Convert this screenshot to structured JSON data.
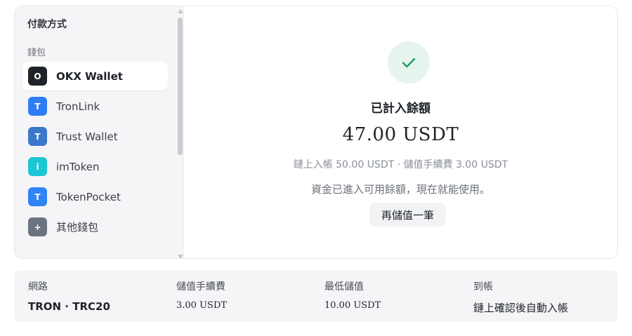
{
  "sidebar": {
    "title": "付款方式",
    "section": "錢包",
    "wallets": [
      {
        "label": "OKX Wallet",
        "icon_text": "O",
        "icon_color": "#1f2329",
        "active": true
      },
      {
        "label": "TronLink",
        "icon_text": "T",
        "icon_color": "#2f7cf6",
        "active": false
      },
      {
        "label": "Trust Wallet",
        "icon_text": "T",
        "icon_color": "#3b78c9",
        "active": false
      },
      {
        "label": "imToken",
        "icon_text": "i",
        "icon_color": "#1cc6d4",
        "active": false
      },
      {
        "label": "TokenPocket",
        "icon_text": "T",
        "icon_color": "#2f84f6",
        "active": false
      },
      {
        "label": "其他錢包",
        "icon_text": "+",
        "icon_color": "#6b7280",
        "active": false
      }
    ]
  },
  "main": {
    "status_title": "已計入餘額",
    "amount": "47.00 USDT",
    "detail": "鏈上入帳 50.00 USDT · 儲值手續費 3.00 USDT",
    "message": "資金已進入可用餘額，現在就能使用。",
    "button_label": "再儲值一筆",
    "accent_color": "#1f9d63"
  },
  "info": {
    "network_label": "網路",
    "network_value": "TRON · TRC20",
    "fee_label": "儲值手續費",
    "fee_value": "3.00 USDT",
    "min_label": "最低儲值",
    "min_value": "10.00 USDT",
    "arrival_label": "到帳",
    "arrival_value": "鏈上確認後自動入帳"
  }
}
